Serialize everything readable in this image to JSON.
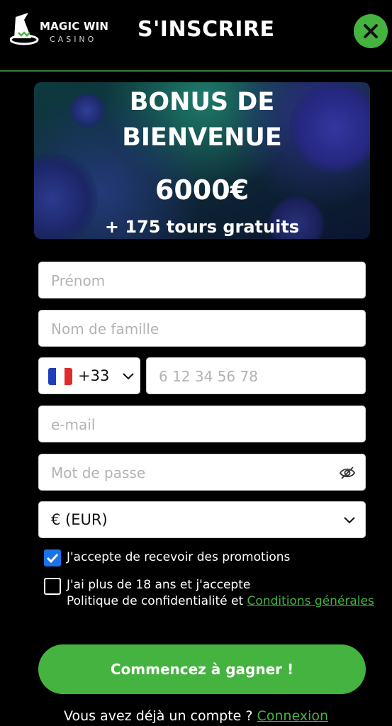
{
  "header": {
    "logo_main": "MAGIC WIN",
    "logo_sub": "CASINO",
    "title": "S'INSCRIRE",
    "close_icon": "close-icon"
  },
  "banner": {
    "line1": "BONUS DE",
    "line2": "BIENVENUE",
    "amount": "6000€",
    "extra": "+ 175 tours gratuits"
  },
  "form": {
    "first_name_placeholder": "Prénom",
    "last_name_placeholder": "Nom de famille",
    "phone_code": "+33",
    "phone_placeholder": "6 12 34 56 78",
    "email_placeholder": "e-mail",
    "password_placeholder": "Mot de passe",
    "currency": "€ (EUR)"
  },
  "consents": {
    "promotions_label": "J'accepte de recevoir des promotions",
    "promotions_checked": true,
    "age_line1": "J'ai plus de 18 ans et j'accepte",
    "age_line2_prefix": "Politique de confidentialité et ",
    "age_link": "Conditions générales",
    "age_checked": false
  },
  "cta": {
    "label": "Commencez à gagner !"
  },
  "footer": {
    "prompt": "Vous avez déjà un compte ? ",
    "login_link": "Connexion"
  },
  "colors": {
    "accent": "#45b33f",
    "checkbox": "#1a73e8",
    "background": "#000000"
  }
}
